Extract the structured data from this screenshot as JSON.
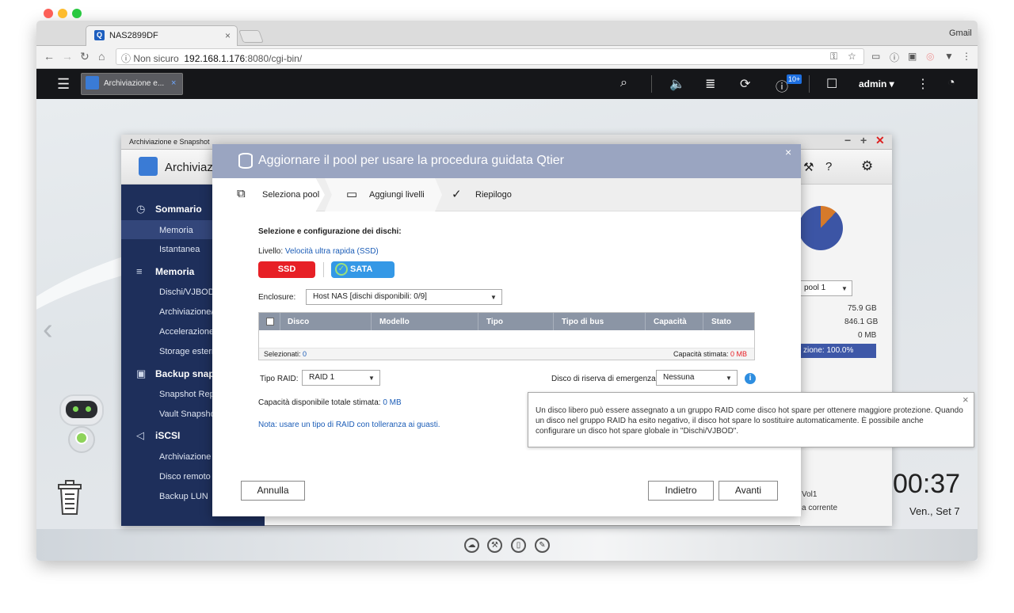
{
  "browser": {
    "tab_title": "NAS2899DF",
    "tab_close": "×",
    "right_label": "Gmail",
    "url_security": "ⓘ Non sicuro",
    "url_host": "192.168.1.176",
    "url_path": ":8080/cgi-bin/"
  },
  "qts_header": {
    "app_tab_label": "Archiviazione e...",
    "notifications_badge": "10+",
    "user": "admin ▾"
  },
  "storage_window": {
    "title": "Archiviazione e Snapshot",
    "app_title": "Archiviazi",
    "sidebar": {
      "sommario": "Sommario",
      "memoria_item": "Memoria",
      "istantanea": "Istantanea",
      "memoria_head": "Memoria",
      "dischi": "Dischi/VJBOD",
      "archiviazione": "Archiviazione/",
      "accelerazione": "Accelerazione",
      "storage_esterno": "Storage esterr",
      "backup_snaps": "Backup snaps",
      "snapshot_rep": "Snapshot Rep",
      "vault_snapshot": "Vault Snapsho",
      "iscsi": "iSCSI",
      "archiviazione2": "Archiviazione",
      "disco_remoto": "Disco remoto",
      "backup_lun": "Backup LUN"
    },
    "right_panel": {
      "pool_select": "pool 1",
      "value1": "75.9 GB",
      "value2": "846.1 GB",
      "value3": "0 MB",
      "status_bar": "zione: 100.0%",
      "vol": "Vol1",
      "corrente": "a corrente"
    }
  },
  "modal": {
    "title": "Aggiornare il pool per usare la procedura guidata Qtier",
    "close": "×",
    "steps": [
      "Seleziona pool",
      "Aggiungi livelli",
      "Riepilogo"
    ],
    "section_title": "Selezione e configurazione dei dischi:",
    "livello_label": "Livello:",
    "livello_value": "Velocità ultra rapida (SSD)",
    "btn_ssd": "SSD",
    "btn_sata": "SATA",
    "enclosure_label": "Enclosure:",
    "enclosure_value": "Host NAS [dischi disponibili: 0/9]",
    "table": {
      "columns": [
        "Disco",
        "Modello",
        "Tipo",
        "Tipo di bus",
        "Capacità",
        "Stato"
      ],
      "selected_label": "Selezionati:",
      "selected_value": "0",
      "capacity_label": "Capacità stimata:",
      "capacity_value": "0 MB"
    },
    "raid_label": "Tipo RAID:",
    "raid_value": "RAID 1",
    "spare_label": "Disco di riserva di emergenza:",
    "spare_value": "Nessuna",
    "total_label": "Capacità disponibile totale stimata:",
    "total_value": "0 MB",
    "note": "Nota: usare un tipo di RAID con tolleranza ai guasti.",
    "btn_cancel": "Annulla",
    "btn_back": "Indietro",
    "btn_next": "Avanti"
  },
  "tooltip": {
    "text": "Un disco libero può essere assegnato a un gruppo RAID come disco hot spare per ottenere maggiore protezione. Quando un disco nel gruppo RAID ha esito negativo, il disco hot spare lo sostituire automaticamente. È possibile anche configurare un disco hot spare globale in \"Dischi/VJBOD\"."
  },
  "desktop": {
    "time": "00:37",
    "date": "Ven., Set 7"
  },
  "colors": {
    "qts_header": "#151619",
    "sidebar": "#1e2f5b",
    "modal_header": "#9aa5c1",
    "ssd_red": "#e72026",
    "sata_blue": "#3498e6"
  }
}
